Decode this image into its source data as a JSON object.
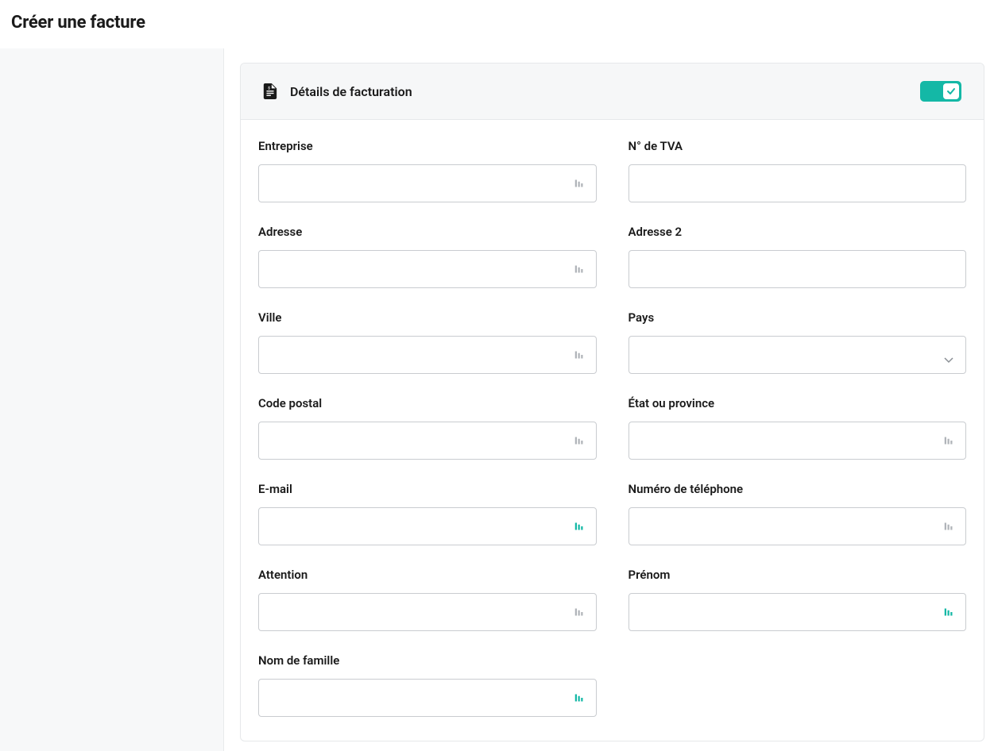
{
  "page": {
    "title": "Créer une facture"
  },
  "card": {
    "title": "Détails de facturation",
    "toggle_on": true
  },
  "fields": {
    "company": {
      "label": "Entreprise",
      "value": "",
      "icon": "muted"
    },
    "vat": {
      "label": "N° de TVA",
      "value": "",
      "icon": "none"
    },
    "address": {
      "label": "Adresse",
      "value": "",
      "icon": "muted"
    },
    "address2": {
      "label": "Adresse 2",
      "value": "",
      "icon": "none"
    },
    "city": {
      "label": "Ville",
      "value": "",
      "icon": "muted"
    },
    "country": {
      "label": "Pays",
      "value": "",
      "type": "select"
    },
    "postal": {
      "label": "Code postal",
      "value": "",
      "icon": "muted"
    },
    "state": {
      "label": "État ou province",
      "value": "",
      "icon": "muted"
    },
    "email": {
      "label": "E-mail",
      "value": "",
      "icon": "accent"
    },
    "phone": {
      "label": "Numéro de téléphone",
      "value": "",
      "icon": "muted"
    },
    "attention": {
      "label": "Attention",
      "value": "",
      "icon": "muted"
    },
    "firstname": {
      "label": "Prénom",
      "value": "",
      "icon": "accent"
    },
    "lastname": {
      "label": "Nom de famille",
      "value": "",
      "icon": "accent"
    }
  }
}
